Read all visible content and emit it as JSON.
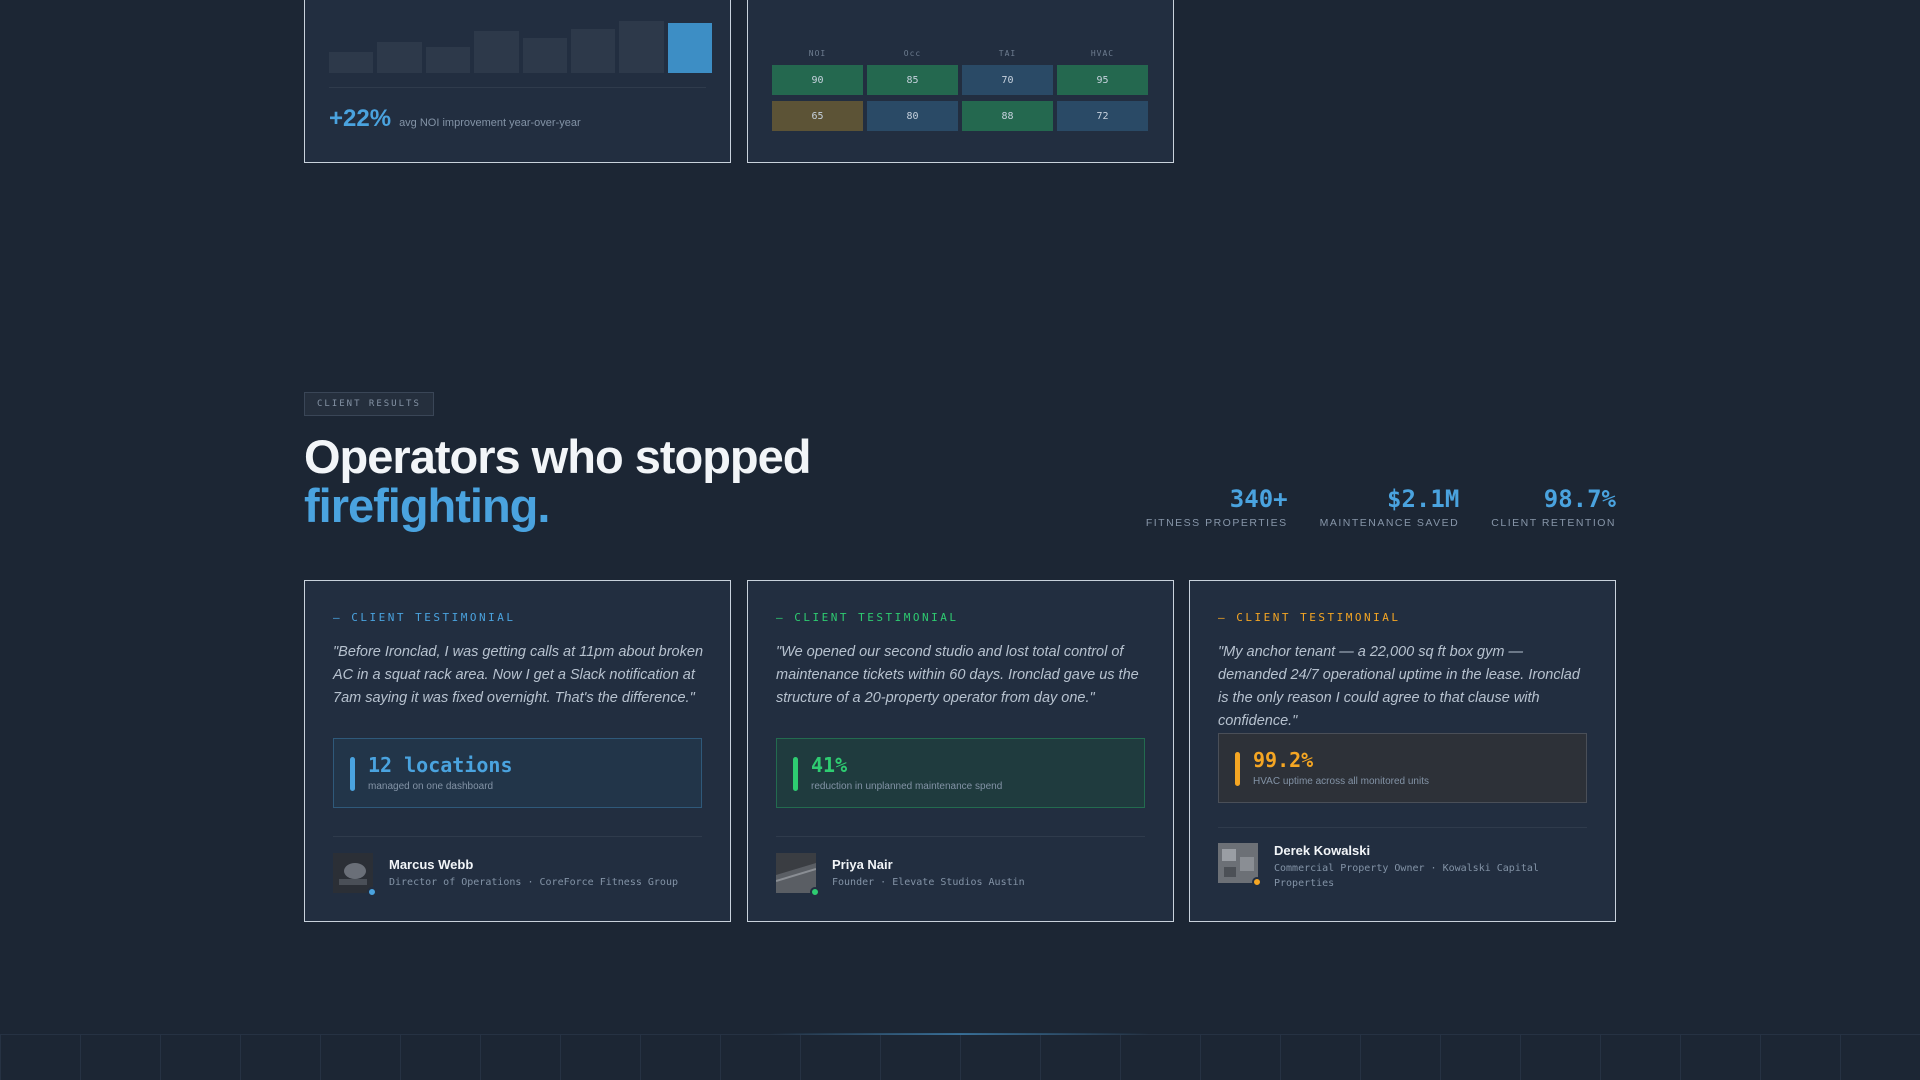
{
  "top_cards": {
    "bar_card": {
      "bars": [
        {
          "value": 0.38
        },
        {
          "value": 0.58
        },
        {
          "value": 0.48
        },
        {
          "value": 0.78
        },
        {
          "value": 0.64
        },
        {
          "value": 0.82
        },
        {
          "value": 0.96
        },
        {
          "value": 0.92,
          "highlight": true
        }
      ],
      "stat_value": "+22%",
      "stat_caption": "avg NOI improvement year-over-year"
    },
    "heat_card": {
      "columns": [
        "NOI",
        "Occ",
        "TAI",
        "HVAC"
      ],
      "rows": [
        [
          {
            "value": "90",
            "tone": "green"
          },
          {
            "value": "85",
            "tone": "green"
          },
          {
            "value": "70",
            "tone": "blue"
          },
          {
            "value": "95",
            "tone": "green"
          }
        ],
        [
          {
            "value": "65",
            "tone": "amber"
          },
          {
            "value": "80",
            "tone": "blue"
          },
          {
            "value": "88",
            "tone": "green"
          },
          {
            "value": "72",
            "tone": "blue"
          }
        ]
      ]
    }
  },
  "section": {
    "tag": "CLIENT RESULTS",
    "headline_line1": "Operators who stopped",
    "headline_line2": "firefighting."
  },
  "metrics": [
    {
      "value": "340+",
      "label": "FITNESS PROPERTIES"
    },
    {
      "value": "$2.1M",
      "label": "MAINTENANCE SAVED"
    },
    {
      "value": "98.7%",
      "label": "CLIENT RETENTION"
    }
  ],
  "testimonials": [
    {
      "label": "— CLIENT TESTIMONIAL",
      "accent": "#4aa3df",
      "stat_bg": "#223549",
      "quote": "\"Before Ironclad, I was getting calls at 11pm about broken AC in a squat rack area. Now I get a Slack notification at 7am saying it was fixed overnight. That's the difference.\"",
      "stat_value": "12 locations",
      "stat_caption": "managed on one dashboard",
      "name": "Marcus Webb",
      "role": "Director of Operations · CoreForce Fitness Group"
    },
    {
      "label": "— CLIENT TESTIMONIAL",
      "accent": "#2ecc71",
      "stat_bg": "#1f3b3e",
      "quote": "\"We opened our second studio and lost total control of maintenance tickets within 60 days. Ironclad gave us the structure of a 20-property operator from day one.\"",
      "stat_value": "41%",
      "stat_caption": "reduction in unplanned maintenance spend",
      "name": "Priya Nair",
      "role": "Founder · Elevate Studios Austin"
    },
    {
      "label": "— CLIENT TESTIMONIAL",
      "accent": "#f5a623",
      "stat_bg": "#2d3138",
      "quote": "\"My anchor tenant — a 22,000 sq ft box gym — demanded 24/7 operational uptime in the lease. Ironclad is the only reason I could agree to that clause with confidence.\"",
      "stat_value": "99.2%",
      "stat_caption": "HVAC uptime across all monitored units",
      "name": "Derek Kowalski",
      "role": "Commercial Property Owner · Kowalski Capital Properties"
    }
  ]
}
